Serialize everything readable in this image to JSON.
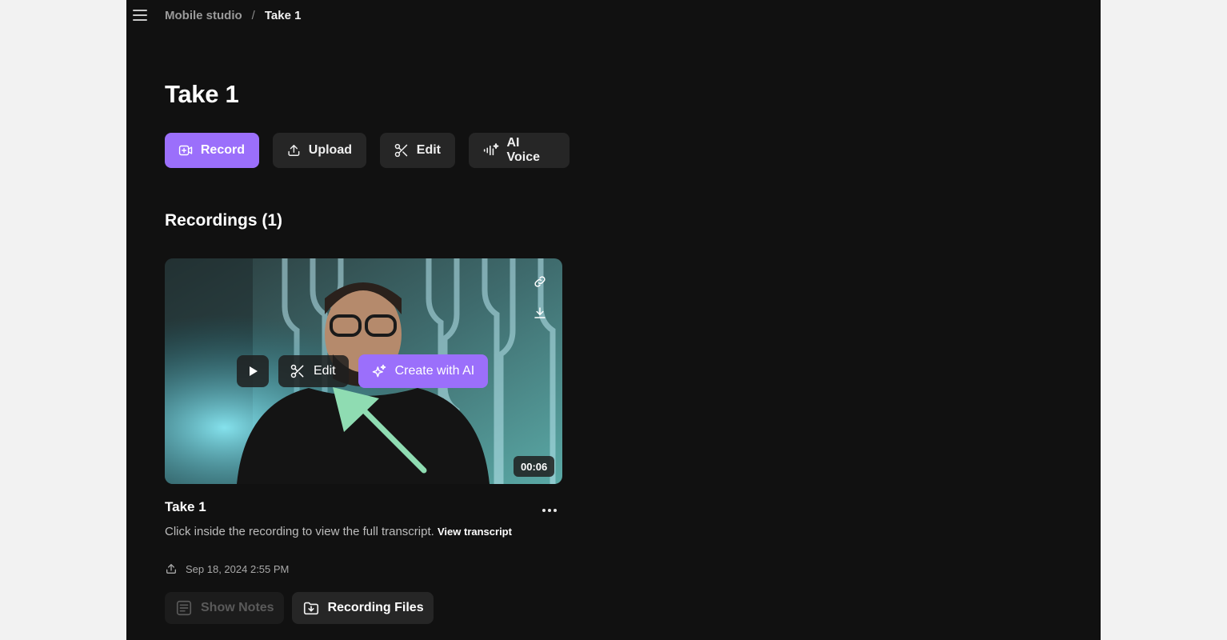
{
  "breadcrumb": {
    "parent": "Mobile studio",
    "separator": "/",
    "current": "Take 1"
  },
  "page": {
    "title": "Take 1"
  },
  "actions": {
    "record": "Record",
    "upload": "Upload",
    "edit": "Edit",
    "ai_voice": "AI Voice"
  },
  "recordings": {
    "section_title": "Recordings (1)"
  },
  "recording": {
    "title": "Take 1",
    "duration": "00:06",
    "description": "Click inside the recording to view the full transcript.",
    "view_transcript": "View transcript",
    "date": "Sep 18, 2024 2:55 PM",
    "overlay": {
      "edit": "Edit",
      "create_ai": "Create with AI"
    }
  },
  "bottom": {
    "show_notes": "Show Notes",
    "recording_files": "Recording Files"
  },
  "colors": {
    "accent": "#9b6ffb",
    "background": "#111111",
    "button": "#262626",
    "annotation_arrow": "#8fdcb2"
  }
}
